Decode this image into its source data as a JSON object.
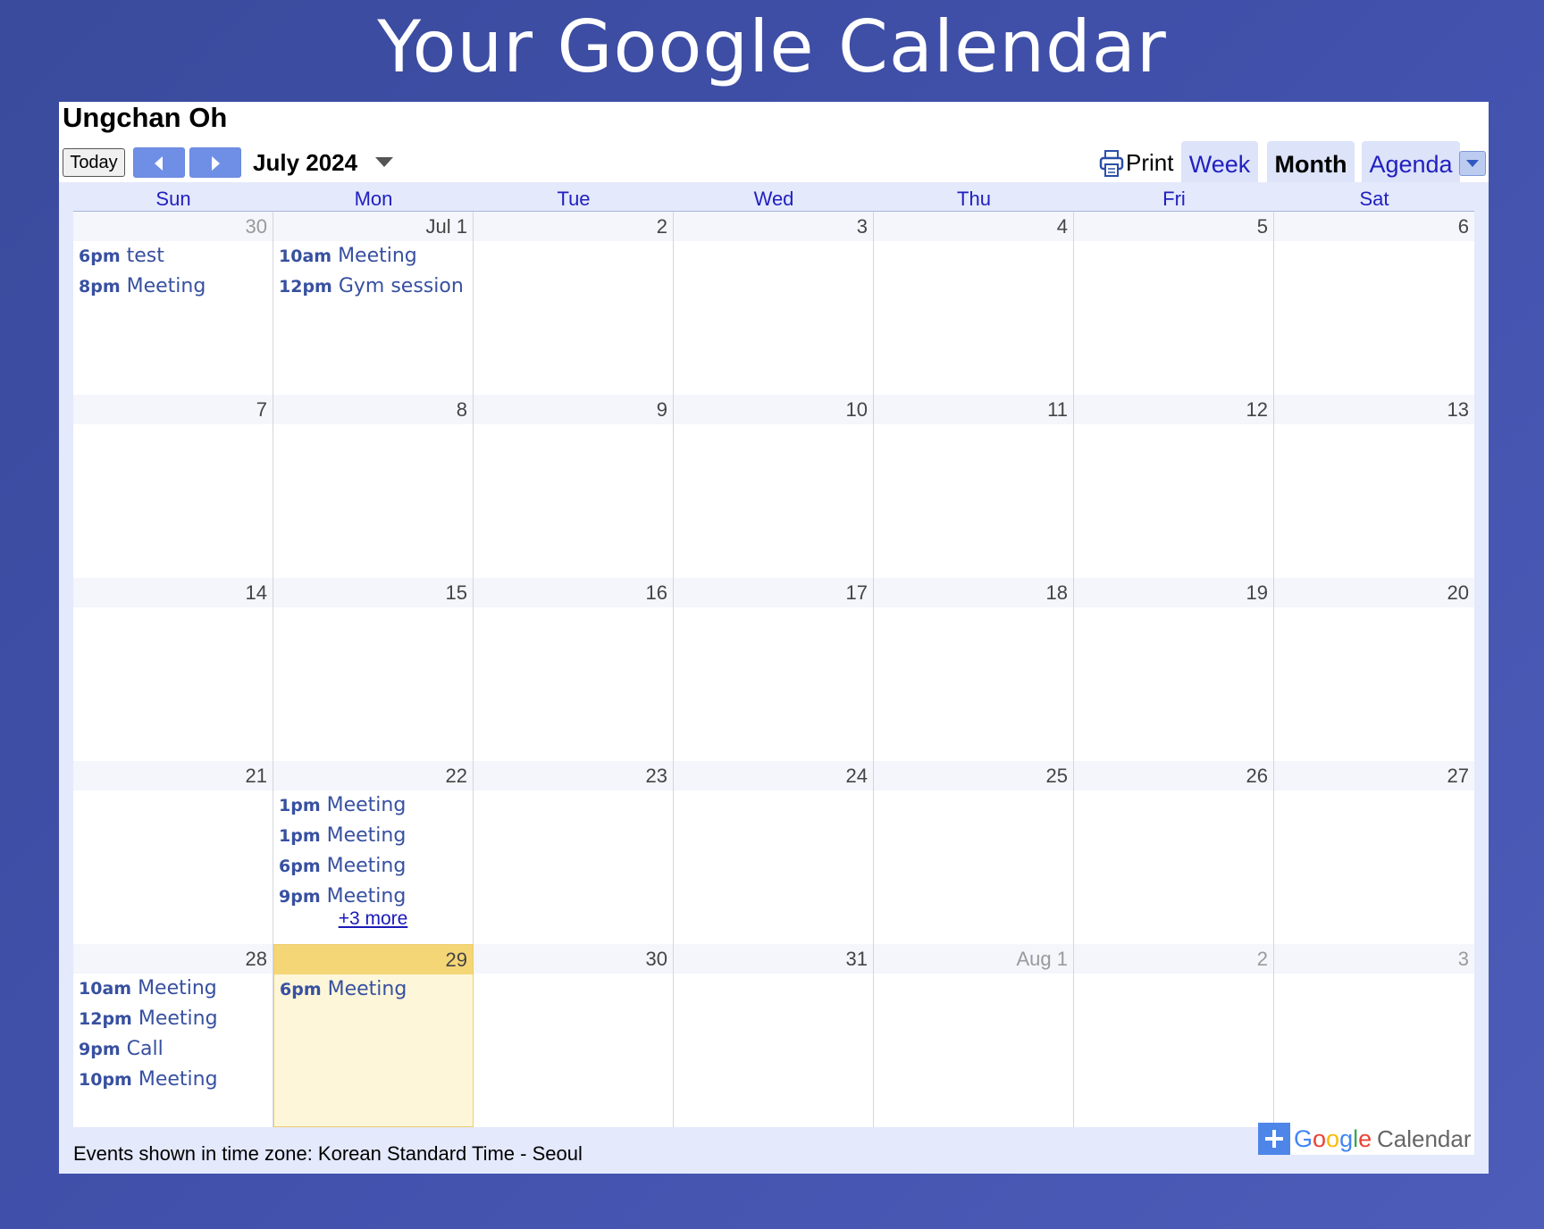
{
  "page": {
    "title": "Your Google Calendar"
  },
  "calendar": {
    "owner": "Ungchan Oh",
    "today_label": "Today",
    "month_label": "July 2024",
    "print_label": "Print",
    "views": {
      "week": "Week",
      "month": "Month",
      "agenda": "Agenda"
    },
    "active_view": "Month",
    "weekdays": [
      "Sun",
      "Mon",
      "Tue",
      "Wed",
      "Thu",
      "Fri",
      "Sat"
    ],
    "weeks": [
      {
        "days": [
          {
            "label": "30",
            "other": true,
            "events": [
              {
                "time": "6pm",
                "title": "test"
              },
              {
                "time": "8pm",
                "title": "Meeting"
              }
            ]
          },
          {
            "label": "Jul 1",
            "events": [
              {
                "time": "10am",
                "title": "Meeting"
              },
              {
                "time": "12pm",
                "title": "Gym session"
              }
            ]
          },
          {
            "label": "2"
          },
          {
            "label": "3"
          },
          {
            "label": "4"
          },
          {
            "label": "5"
          },
          {
            "label": "6"
          }
        ]
      },
      {
        "days": [
          {
            "label": "7"
          },
          {
            "label": "8"
          },
          {
            "label": "9"
          },
          {
            "label": "10"
          },
          {
            "label": "11"
          },
          {
            "label": "12"
          },
          {
            "label": "13"
          }
        ]
      },
      {
        "days": [
          {
            "label": "14"
          },
          {
            "label": "15"
          },
          {
            "label": "16"
          },
          {
            "label": "17"
          },
          {
            "label": "18"
          },
          {
            "label": "19"
          },
          {
            "label": "20"
          }
        ]
      },
      {
        "days": [
          {
            "label": "21"
          },
          {
            "label": "22",
            "events": [
              {
                "time": "1pm",
                "title": "Meeting"
              },
              {
                "time": "1pm",
                "title": "Meeting"
              },
              {
                "time": "6pm",
                "title": "Meeting"
              },
              {
                "time": "9pm",
                "title": "Meeting"
              }
            ],
            "more": "+3 more"
          },
          {
            "label": "23"
          },
          {
            "label": "24"
          },
          {
            "label": "25"
          },
          {
            "label": "26"
          },
          {
            "label": "27"
          }
        ]
      },
      {
        "days": [
          {
            "label": "28",
            "events": [
              {
                "time": "10am",
                "title": "Meeting"
              },
              {
                "time": "12pm",
                "title": "Meeting"
              },
              {
                "time": "9pm",
                "title": "Call"
              },
              {
                "time": "10pm",
                "title": "Meeting"
              }
            ]
          },
          {
            "label": "29",
            "today": true,
            "events": [
              {
                "time": "6pm",
                "title": "Meeting"
              }
            ]
          },
          {
            "label": "30"
          },
          {
            "label": "31"
          },
          {
            "label": "Aug 1",
            "other": true
          },
          {
            "label": "2",
            "other": true
          },
          {
            "label": "3",
            "other": true
          }
        ]
      }
    ],
    "timezone_note": "Events shown in time zone: Korean Standard Time - Seoul",
    "badge": {
      "google": "Google",
      "calendar": "Calendar"
    },
    "colors": {
      "event_text": "#3750a0",
      "today_highlight": "#f5d677",
      "header_band": "#e4e9fb",
      "link": "#2020c0"
    },
    "icons": {
      "prev": "chevron-left-icon",
      "next": "chevron-right-icon",
      "print": "printer-icon",
      "dropdown": "caret-down-icon",
      "add": "plus-icon"
    }
  }
}
